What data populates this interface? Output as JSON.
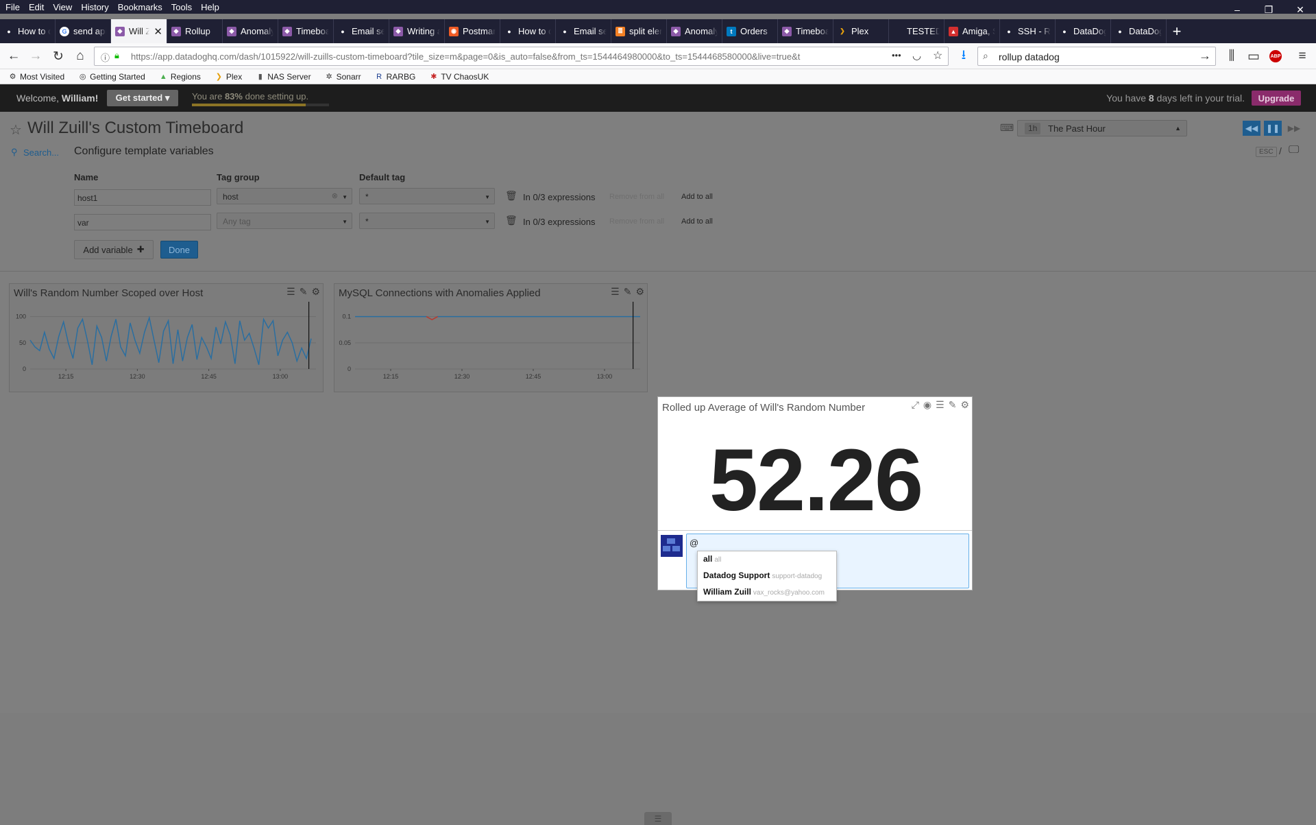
{
  "menu": [
    "File",
    "Edit",
    "View",
    "History",
    "Bookmarks",
    "Tools",
    "Help"
  ],
  "window_controls": [
    "–",
    "❐",
    "✕"
  ],
  "tabs": [
    {
      "label": "How to c",
      "icon": "github-icon",
      "color": "#1f2034"
    },
    {
      "label": "send api",
      "icon": "google-icon",
      "color": "#ffffff"
    },
    {
      "label": "Will Z",
      "icon": "datadog-icon",
      "color": "#8c5aa8",
      "active": true
    },
    {
      "label": "Rollup",
      "icon": "datadog-icon",
      "color": "#8c5aa8"
    },
    {
      "label": "Anomaly",
      "icon": "datadog-icon",
      "color": "#8c5aa8"
    },
    {
      "label": "Timeboa",
      "icon": "datadog-icon",
      "color": "#8c5aa8"
    },
    {
      "label": "Email set",
      "icon": "github-icon",
      "color": "#1f2034"
    },
    {
      "label": "Writing a",
      "icon": "datadog-icon",
      "color": "#8c5aa8"
    },
    {
      "label": "Postman",
      "icon": "postman-icon",
      "color": "#ef5b25"
    },
    {
      "label": "How to c",
      "icon": "github-icon",
      "color": "#1f2034"
    },
    {
      "label": "Email set",
      "icon": "github-icon",
      "color": "#1f2034"
    },
    {
      "label": "split elen",
      "icon": "stackoverflow-icon",
      "color": "#f48024"
    },
    {
      "label": "Anomaly",
      "icon": "datadog-icon",
      "color": "#8c5aa8"
    },
    {
      "label": "Orders",
      "icon": "trello-icon",
      "color": "#0079bf"
    },
    {
      "label": "Timeboa",
      "icon": "datadog-icon",
      "color": "#8c5aa8"
    },
    {
      "label": "Plex",
      "icon": "plex-icon",
      "color": "#e5a00d"
    },
    {
      "label": "TESTED and",
      "icon": "blank-icon",
      "color": "#1f2034"
    },
    {
      "label": "Amiga, S",
      "icon": "amiga-icon",
      "color": "#d32f2f"
    },
    {
      "label": "SSH - Ret",
      "icon": "github-icon",
      "color": "#1f2034"
    },
    {
      "label": "DataDog",
      "icon": "github-icon",
      "color": "#1f2034"
    },
    {
      "label": "DataDog",
      "icon": "github-icon",
      "color": "#1f2034"
    }
  ],
  "nav": {
    "url_host": "https://app.datadoghq.com",
    "url_path": "/dash/1015922/will-zuills-custom-timeboard?tile_size=m&page=0&is_auto=false&from_ts=1544464980000&to_ts=1544468580000&live=true&t",
    "more": "•••",
    "search_value": "rollup datadog"
  },
  "bookmarks": [
    {
      "label": "Most Visited",
      "icon": "gear-icon"
    },
    {
      "label": "Getting Started",
      "icon": "globe-icon"
    },
    {
      "label": "Regions",
      "icon": "mountain-icon"
    },
    {
      "label": "Plex",
      "icon": "plex-icon"
    },
    {
      "label": "NAS Server",
      "icon": "server-icon"
    },
    {
      "label": "Sonarr",
      "icon": "sonarr-icon"
    },
    {
      "label": "RARBG",
      "icon": "rarbg-icon"
    },
    {
      "label": "TV ChaosUK",
      "icon": "tv-icon"
    }
  ],
  "topbar": {
    "welcome_prefix": "Welcome, ",
    "welcome_name": "William!",
    "get_started": "Get started ▾",
    "progress_prefix": "You are ",
    "progress_pct": "83%",
    "progress_suffix": " done setting up.",
    "progress_value": 0.83,
    "trial_prefix": "You have ",
    "trial_days": "8",
    "trial_suffix": " days left in your trial.",
    "upgrade": "Upgrade"
  },
  "dashboard": {
    "title": "Will Zuill's Custom Timeboard",
    "search": "Search...",
    "config_title": "Configure template variables",
    "time_badge": "1h",
    "time_label": "The Past Hour",
    "esc": "ESC",
    "slash": "/"
  },
  "template_vars": {
    "headers": {
      "name": "Name",
      "tag_group": "Tag group",
      "default_tag": "Default tag"
    },
    "rows": [
      {
        "name": "host1",
        "tag_group": "host",
        "tag_placeholder": "",
        "default_tag": "*",
        "expressions": "In 0/3 expressions",
        "remove": "Remove from all",
        "add": "Add to all"
      },
      {
        "name": "var",
        "tag_group": "",
        "tag_placeholder": "Any tag",
        "default_tag": "*",
        "expressions": "In 0/3 expressions",
        "remove": "Remove from all",
        "add": "Add to all"
      }
    ],
    "add_variable": "Add variable",
    "done": "Done"
  },
  "widgets": {
    "w1_title": "Will's Random Number Scoped over Host",
    "w2_title": "MySQL Connections with Anomalies Applied",
    "qv_title": "Rolled up Average of Will's Random Number",
    "qv_value": "52.26",
    "comment_text": "@",
    "mentions": [
      {
        "name": "all",
        "handle": "all"
      },
      {
        "name": "Datadog Support",
        "handle": "support-datadog"
      },
      {
        "name": "William Zuill",
        "handle": "vax_rocks@yahoo.com"
      }
    ]
  },
  "chart_data": [
    {
      "type": "line",
      "title": "Will's Random Number Scoped over Host",
      "x_ticks": [
        "12:15",
        "12:30",
        "12:45",
        "13:00"
      ],
      "y_ticks": [
        "0",
        "50",
        "100"
      ],
      "ylim": [
        0,
        110
      ],
      "xlim": [
        0,
        60
      ],
      "x": [
        0,
        1,
        2,
        3,
        4,
        5,
        6,
        7,
        8,
        9,
        10,
        11,
        12,
        13,
        14,
        15,
        16,
        17,
        18,
        19,
        20,
        21,
        22,
        23,
        24,
        25,
        26,
        27,
        28,
        29,
        30,
        31,
        32,
        33,
        34,
        35,
        36,
        37,
        38,
        39,
        40,
        41,
        42,
        43,
        44,
        45,
        46,
        47,
        48,
        49,
        50,
        51,
        52,
        53,
        54,
        55,
        56,
        57,
        58,
        59
      ],
      "values": [
        55,
        42,
        35,
        70,
        38,
        20,
        62,
        90,
        50,
        20,
        78,
        95,
        55,
        8,
        82,
        60,
        15,
        62,
        95,
        42,
        25,
        88,
        55,
        30,
        70,
        98,
        55,
        12,
        72,
        92,
        10,
        75,
        15,
        60,
        85,
        18,
        60,
        42,
        20,
        80,
        48,
        90,
        65,
        10,
        92,
        55,
        68,
        40,
        8,
        95,
        78,
        92,
        25,
        55,
        70,
        50,
        15,
        40,
        20,
        58
      ],
      "grid": true,
      "marker_x": 58.5
    },
    {
      "type": "line",
      "title": "MySQL Connections with Anomalies Applied",
      "x_ticks": [
        "12:15",
        "12:30",
        "12:45",
        "13:00"
      ],
      "y_ticks": [
        "0",
        "0.05",
        "0.1"
      ],
      "ylim": [
        0,
        0.11
      ],
      "xlim": [
        0,
        60
      ],
      "x": [
        0,
        15,
        16.2,
        17.4,
        60
      ],
      "values": [
        0.1,
        0.1,
        0.094,
        0.1,
        0.1
      ],
      "anomaly_x": [
        15,
        17.4
      ],
      "grid": true,
      "marker_x": 58.5
    }
  ],
  "colors": {
    "brand_purple": "#632ca6",
    "series_blue": "#2a6ea0",
    "anomaly_red": "#c0392b",
    "done_button": "#2e7cbf",
    "upgrade_button": "#8a2b6b"
  }
}
